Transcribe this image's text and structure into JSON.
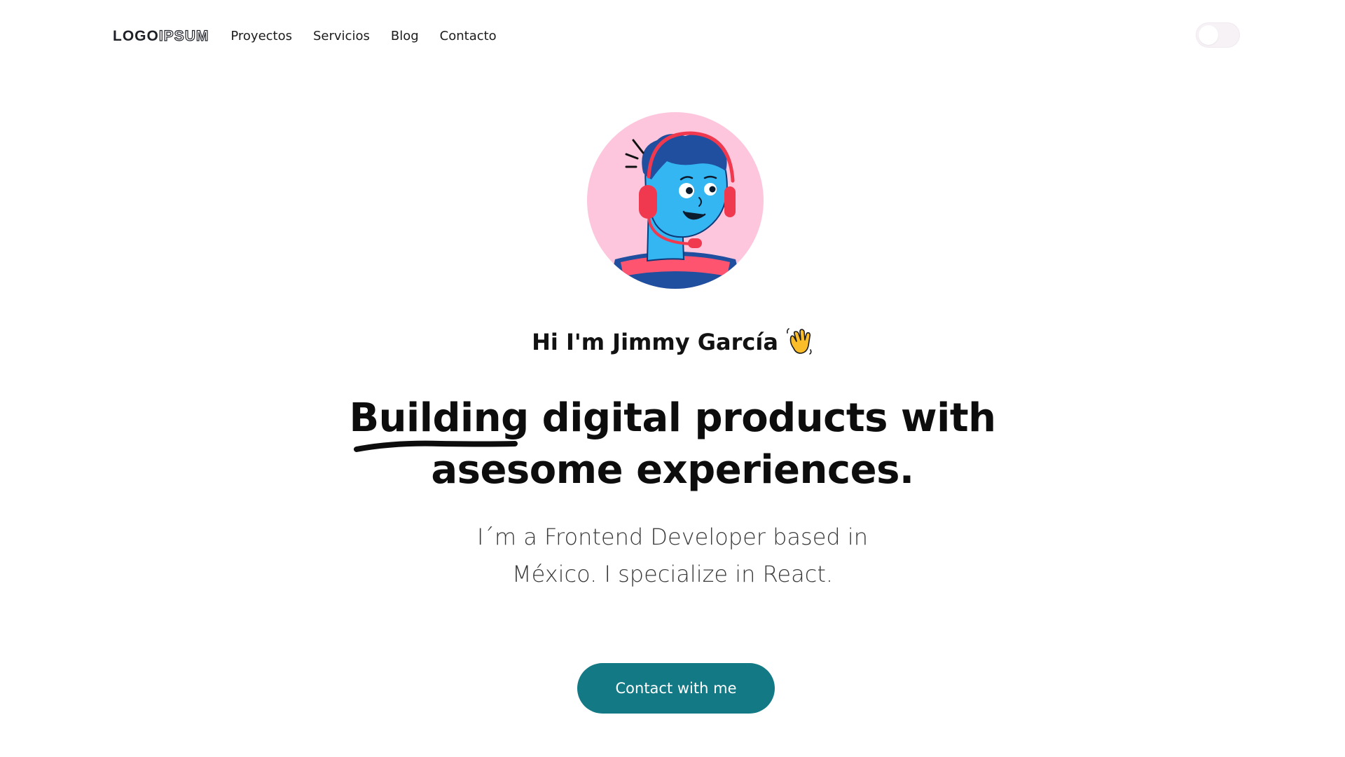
{
  "nav": {
    "logo_bold": "LOGO",
    "logo_outline": "IPSUM",
    "links": [
      {
        "label": "Proyectos"
      },
      {
        "label": "Servicios"
      },
      {
        "label": "Blog"
      },
      {
        "label": "Contacto"
      }
    ],
    "theme_toggle": {
      "state": "off"
    }
  },
  "hero": {
    "avatar_icon": "developer-headset-avatar-icon",
    "greeting": "Hi I'm Jimmy García",
    "greeting_icon": "waving-hand-icon",
    "headline_underlined": "Building",
    "headline_rest": " digital products with",
    "headline_line2": "asesome experiences.",
    "subtitle_line1": "I´m a Frontend Developer based in",
    "subtitle_line2": "México. I specialize in React.",
    "cta_label": "Contact with me"
  },
  "colors": {
    "accent": "#127985",
    "avatar_bg": "#fdc6dd",
    "text": "#111111"
  }
}
